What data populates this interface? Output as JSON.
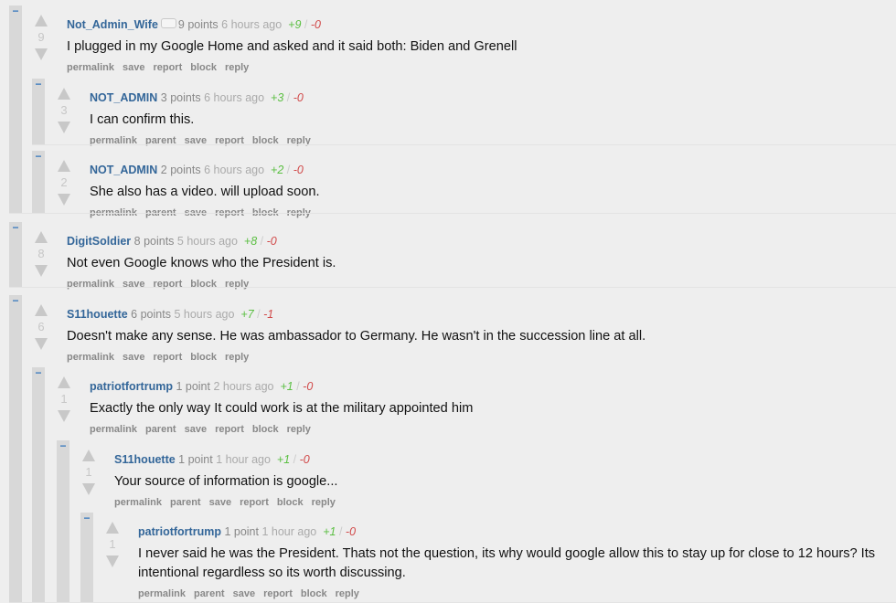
{
  "comments": [
    {
      "author": "Not_Admin_Wife",
      "points": "9 points",
      "age": "6 hours ago",
      "up": "+9",
      "down": "-0",
      "score": "9",
      "text": "I plugged in my Google Home and asked and it said both: Biden and Grenell",
      "buttons": [
        "permalink",
        "save",
        "report",
        "block",
        "reply"
      ]
    },
    {
      "author": "NOT_ADMIN",
      "points": "3 points",
      "age": "6 hours ago",
      "up": "+3",
      "down": "-0",
      "score": "3",
      "text": "I can confirm this.",
      "buttons": [
        "permalink",
        "parent",
        "save",
        "report",
        "block",
        "reply"
      ]
    },
    {
      "author": "NOT_ADMIN",
      "points": "2 points",
      "age": "6 hours ago",
      "up": "+2",
      "down": "-0",
      "score": "2",
      "text": "She also has a video. will upload soon.",
      "buttons": [
        "permalink",
        "parent",
        "save",
        "report",
        "block",
        "reply"
      ]
    },
    {
      "author": "DigitSoldier",
      "points": "8 points",
      "age": "5 hours ago",
      "up": "+8",
      "down": "-0",
      "score": "8",
      "text": "Not even Google knows who the President is.",
      "buttons": [
        "permalink",
        "save",
        "report",
        "block",
        "reply"
      ]
    },
    {
      "author": "S11houette",
      "points": "6 points",
      "age": "5 hours ago",
      "up": "+7",
      "down": "-1",
      "score": "6",
      "text": "Doesn't make any sense. He was ambassador to Germany. He wasn't in the succession line at all.",
      "buttons": [
        "permalink",
        "save",
        "report",
        "block",
        "reply"
      ]
    },
    {
      "author": "patriotfortrump",
      "points": "1 point",
      "age": "2 hours ago",
      "up": "+1",
      "down": "-0",
      "score": "1",
      "text": "Exactly the only way It could work is at the military appointed him",
      "buttons": [
        "permalink",
        "parent",
        "save",
        "report",
        "block",
        "reply"
      ]
    },
    {
      "author": "S11houette",
      "points": "1 point",
      "age": "1 hour ago",
      "up": "+1",
      "down": "-0",
      "score": "1",
      "text": "Your source of information is google...",
      "buttons": [
        "permalink",
        "parent",
        "save",
        "report",
        "block",
        "reply"
      ]
    },
    {
      "author": "patriotfortrump",
      "points": "1 point",
      "age": "1 hour ago",
      "up": "+1",
      "down": "-0",
      "score": "1",
      "text": "I never said he was the President. Thats not the question, its why would google allow this to stay up for close to 12 hours? Its intentional regardless so its worth discussing.",
      "buttons": [
        "permalink",
        "parent",
        "save",
        "report",
        "block",
        "reply"
      ]
    }
  ],
  "ui": {
    "collapse_symbol": "−",
    "slash": "/"
  }
}
